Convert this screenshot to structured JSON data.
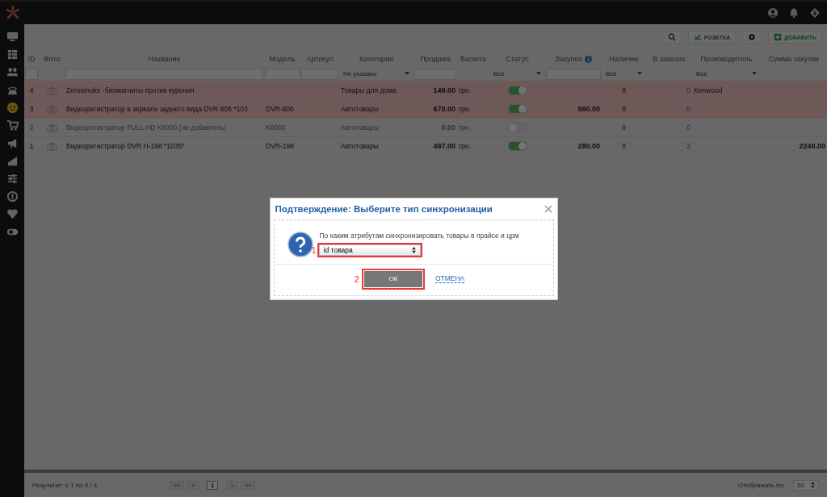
{
  "sidebar": {
    "items": [
      {
        "selected": false
      },
      {
        "selected": false
      },
      {
        "selected": false
      },
      {
        "selected": false
      },
      {
        "selected": true
      },
      {
        "selected": false
      },
      {
        "selected": false
      },
      {
        "selected": false
      },
      {
        "selected": false
      },
      {
        "selected": false
      },
      {
        "selected": false
      },
      {
        "selected": false
      }
    ]
  },
  "toolbar": {
    "buttons": [
      {
        "kind": "search"
      },
      {
        "kind": "rozetka",
        "label": "РОЗЕТКА"
      },
      {
        "kind": "settings"
      },
      {
        "kind": "add",
        "label": "ДОБАВИТЬ"
      }
    ]
  },
  "table": {
    "columns": [
      {
        "label": "ID"
      },
      {
        "label": "Фото"
      },
      {
        "label": "Название"
      },
      {
        "label": "Модель"
      },
      {
        "label": "Артикул"
      },
      {
        "label": "Категория"
      },
      {
        "label": "Продажа"
      },
      {
        "label": "Валюта"
      },
      {
        "label": "Статус"
      },
      {
        "label": "Закупка",
        "info": true
      },
      {
        "label": "Наличие"
      },
      {
        "label": "В заказах"
      },
      {
        "label": "Производитель"
      },
      {
        "label": "Сумма закупки"
      }
    ],
    "filters": [
      {
        "kind": "input"
      },
      {
        "kind": "none"
      },
      {
        "kind": "input"
      },
      {
        "kind": "input"
      },
      {
        "kind": "input"
      },
      {
        "kind": "select",
        "value": "Не указано"
      },
      {
        "kind": "input"
      },
      {
        "kind": "none"
      },
      {
        "kind": "select",
        "value": "Все"
      },
      {
        "kind": "input"
      },
      {
        "kind": "select",
        "value": "Все"
      },
      {
        "kind": "none"
      },
      {
        "kind": "select",
        "value": "Все"
      },
      {
        "kind": "none"
      }
    ],
    "rows": [
      {
        "id": "4",
        "name": "Zerosmoke -биомагниты против курения",
        "model": "",
        "sku": "",
        "category": "Товары для дома",
        "sale": "149.00",
        "currency": "грн.",
        "on": true,
        "purchase": "",
        "stock": {
          "value": "0",
          "kind": "out"
        },
        "orders": "0",
        "manufacturer": "Kenwood",
        "sum": "",
        "highlighted": true,
        "disabled": false
      },
      {
        "id": "3",
        "name": "Видеорегистратор в зеркале заднего вида DVR 806 *103",
        "model": "DVR-806",
        "sku": "",
        "category": "Автотовары",
        "sale": "670.00",
        "currency": "грн.",
        "on": true,
        "purchase": "560.00",
        "stock": {
          "value": "0",
          "kind": "out"
        },
        "orders": "0",
        "manufacturer": "",
        "sum": "",
        "highlighted": true,
        "disabled": false
      },
      {
        "id": "2",
        "name": "Видеорегистратор FULL HD K6000 (не добавлять)",
        "model": "K6000",
        "sku": "",
        "category": "Автотовары",
        "sale": "0.00",
        "currency": "грн.",
        "on": false,
        "purchase": "",
        "stock": {
          "value": "0",
          "kind": "inactive"
        },
        "orders": "0",
        "manufacturer": "",
        "sum": "",
        "highlighted": false,
        "disabled": true
      },
      {
        "id": "1",
        "name": "Видеорегистратор DVR H-198 *1035*",
        "model": "DVR-198",
        "sku": "",
        "category": "Автотовары",
        "sale": "497.00",
        "currency": "грн.",
        "on": true,
        "purchase": "280.00",
        "stock": {
          "value": "8",
          "kind": "in"
        },
        "orders": "2",
        "manufacturer": "",
        "sum": "2240.00",
        "highlighted": false,
        "disabled": false
      }
    ]
  },
  "footer": {
    "result": "Результат:  с 1 по 4 / 4",
    "pages": [
      {
        "label": "<<",
        "selected": false
      },
      {
        "label": "<",
        "selected": false
      },
      {
        "label": "1",
        "selected": true
      },
      {
        "label": ">",
        "selected": false
      },
      {
        "label": ">>",
        "selected": false
      }
    ],
    "per_page_label": "Отображать по:",
    "per_page": "50"
  },
  "dialog": {
    "title": "Подтверждение:  Выберите тип синхронизации",
    "message": "По каким атрибутам синхронизировать товары в прайсе и црм",
    "select": {
      "value": "id товара",
      "marker": "1",
      "highlighted": true
    },
    "ok": {
      "label": "ОК",
      "marker": "2",
      "highlighted": true
    },
    "cancel": "ОТМЕНА"
  }
}
